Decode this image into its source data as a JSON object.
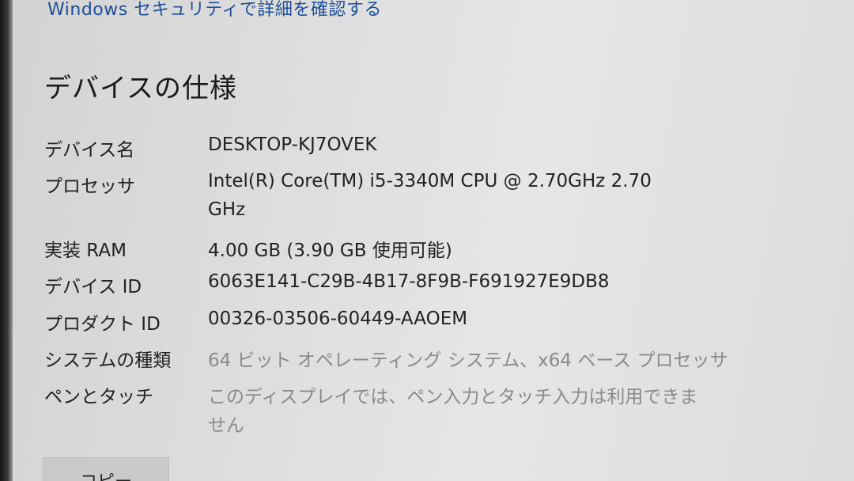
{
  "top_link": "Windows セキュリティで詳細を確認する",
  "section_title": "デバイスの仕様",
  "specs": [
    {
      "label": "デバイス名",
      "value": "DESKTOP-KJ7OVEK"
    },
    {
      "label": "プロセッサ",
      "value": "Intel(R) Core(TM) i5-3340M CPU @ 2.70GHz   2.70",
      "value_cont": "GHz"
    },
    {
      "label": "実装 RAM",
      "value": "4.00 GB (3.90 GB 使用可能)"
    },
    {
      "label": "デバイス ID",
      "value": "6063E141-C29B-4B17-8F9B-F691927E9DB8"
    },
    {
      "label": "プロダクト ID",
      "value": "00326-03506-60449-AAOEM"
    },
    {
      "label": "システムの種類",
      "value": "64 ビット オペレーティング システム、x64 ベース プロセッサ"
    },
    {
      "label": "ペンとタッチ",
      "value": "このディスプレイでは、ペン入力とタッチ入力は利用できま",
      "value_cont": "せん"
    }
  ],
  "copy_button_label": "コピー"
}
